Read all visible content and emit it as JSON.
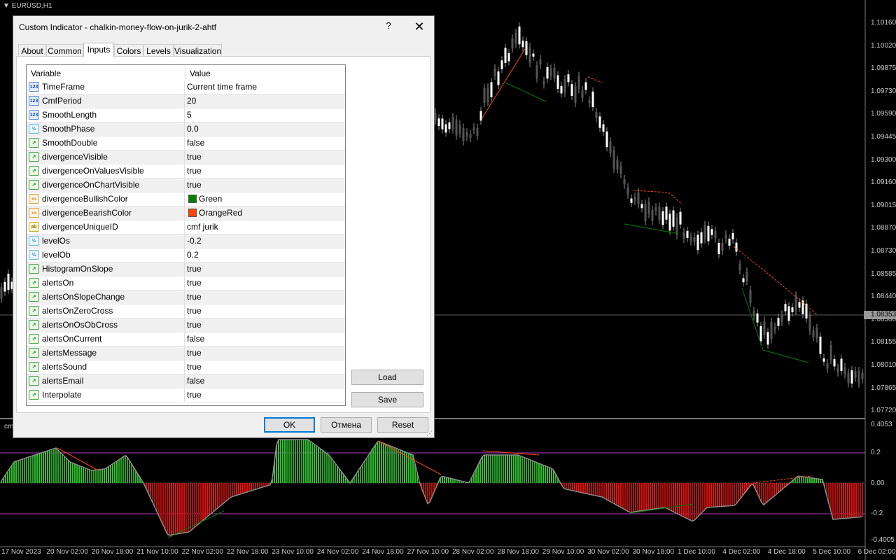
{
  "chart": {
    "symbol": "EURUSD,H1",
    "indicator_short": "cm",
    "price_ticks": [
      "1.10160",
      "1.10020",
      "1.09875",
      "1.09730",
      "1.09590",
      "1.09445",
      "1.09300",
      "1.09160",
      "1.09015",
      "1.08870",
      "1.08730",
      "1.08585",
      "1.08440",
      "1.08300",
      "1.08155",
      "1.08010",
      "1.07865",
      "1.07720"
    ],
    "current_price": "1.08353",
    "indicator_ticks": [
      "0.4053",
      "0.2",
      "0.00",
      "-0.2",
      "-0.4005"
    ],
    "time_ticks": [
      "17 Nov 2023",
      "20 Nov 02:00",
      "20 Nov 18:00",
      "21 Nov 10:00",
      "22 Nov 02:00",
      "22 Nov 18:00",
      "23 Nov 10:00",
      "24 Nov 02:00",
      "24 Nov 18:00",
      "27 Nov 10:00",
      "28 Nov 02:00",
      "28 Nov 18:00",
      "29 Nov 10:00",
      "30 Nov 02:00",
      "30 Nov 18:00",
      "1 Dec 10:00",
      "4 Dec 02:00",
      "4 Dec 18:00",
      "5 Dec 10:00",
      "6 Dec 02:00"
    ],
    "colors": {
      "bullish": "#008000",
      "bearish": "#ff4500",
      "level": "#b040c0",
      "candle": "#8c8c8c"
    }
  },
  "dialog": {
    "title": "Custom Indicator - chalkin-money-flow-on-jurik-2-ahtf",
    "help_label": "?",
    "close_label": "✕",
    "tabs": [
      "About",
      "Common",
      "Inputs",
      "Colors",
      "Levels",
      "Visualization"
    ],
    "active_tab": "Inputs",
    "columns": {
      "variable": "Variable",
      "value": "Value"
    },
    "rows": [
      {
        "icon": "int",
        "name": "TimeFrame",
        "value": "Current time frame"
      },
      {
        "icon": "int",
        "name": "CmfPeriod",
        "value": "20"
      },
      {
        "icon": "int",
        "name": "SmoothLength",
        "value": "5"
      },
      {
        "icon": "dbl",
        "name": "SmoothPhase",
        "value": "0.0"
      },
      {
        "icon": "bool",
        "name": "SmoothDouble",
        "value": "false"
      },
      {
        "icon": "bool",
        "name": "divergenceVisible",
        "value": "true"
      },
      {
        "icon": "bool",
        "name": "divergenceOnValuesVisible",
        "value": "true"
      },
      {
        "icon": "bool",
        "name": "divergenceOnChartVisible",
        "value": "true"
      },
      {
        "icon": "color",
        "name": "divergenceBullishColor",
        "value": "Green",
        "swatch": "#008000"
      },
      {
        "icon": "color",
        "name": "divergenceBearishColor",
        "value": "OrangeRed",
        "swatch": "#ff4500"
      },
      {
        "icon": "str",
        "name": "divergenceUniqueID",
        "value": "cmf jurik"
      },
      {
        "icon": "dbl",
        "name": "levelOs",
        "value": "-0.2"
      },
      {
        "icon": "dbl",
        "name": "levelOb",
        "value": "0.2"
      },
      {
        "icon": "bool",
        "name": "HistogramOnSlope",
        "value": "true"
      },
      {
        "icon": "bool",
        "name": "alertsOn",
        "value": "true"
      },
      {
        "icon": "bool",
        "name": "alertsOnSlopeChange",
        "value": "true"
      },
      {
        "icon": "bool",
        "name": "alertsOnZeroCross",
        "value": "true"
      },
      {
        "icon": "bool",
        "name": "alertsOnOsObCross",
        "value": "true"
      },
      {
        "icon": "bool",
        "name": "alertsOnCurrent",
        "value": "false"
      },
      {
        "icon": "bool",
        "name": "alertsMessage",
        "value": "true"
      },
      {
        "icon": "bool",
        "name": "alertsSound",
        "value": "true"
      },
      {
        "icon": "bool",
        "name": "alertsEmail",
        "value": "false"
      },
      {
        "icon": "bool",
        "name": "Interpolate",
        "value": "true"
      }
    ],
    "load_label": "Load",
    "save_label": "Save",
    "ok_label": "OK",
    "cancel_label": "Отмена",
    "reset_label": "Reset"
  }
}
